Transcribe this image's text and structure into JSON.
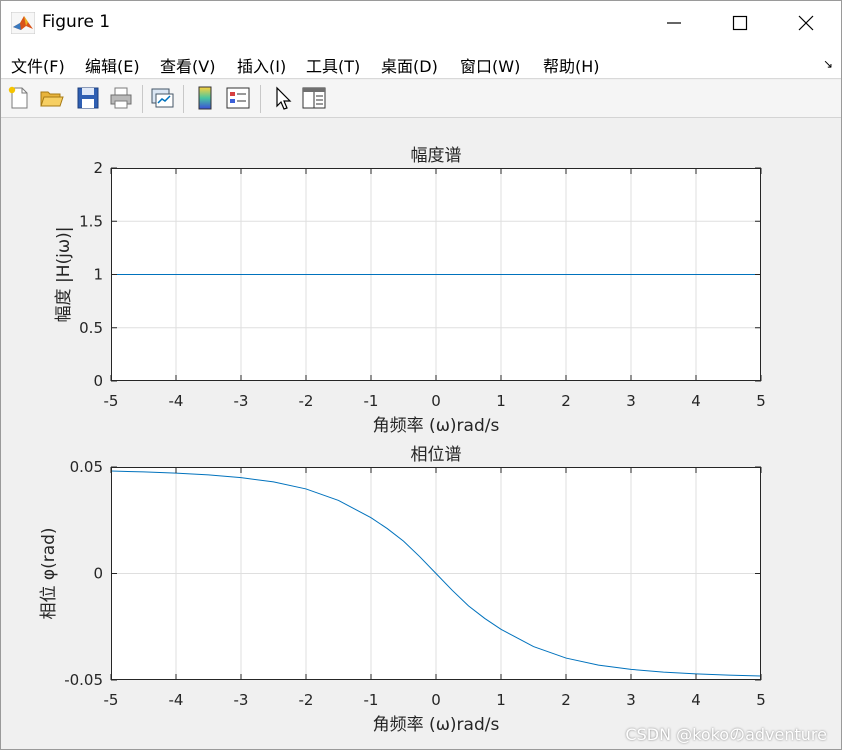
{
  "window": {
    "title": "Figure 1"
  },
  "menu": [
    "文件(F)",
    "编辑(E)",
    "查看(V)",
    "插入(I)",
    "工具(T)",
    "桌面(D)",
    "窗口(W)",
    "帮助(H)"
  ],
  "toolbar_icons": [
    "new-file-icon",
    "open-folder-icon",
    "save-icon",
    "print-icon",
    "link-plot-icon",
    "colorbar-icon",
    "legend-icon",
    "cursor-icon",
    "property-inspector-icon"
  ],
  "colors": {
    "line": "#0072bd",
    "grid": "#dfdfdf",
    "axes_bg": "#ffffff",
    "figure_bg": "#f0f0f0"
  },
  "watermark": "CSDN @kokoのadventure",
  "chart_data": [
    {
      "type": "line",
      "title": "幅度谱",
      "xlabel": "角频率 (ω)rad/s",
      "ylabel": "幅度 |H(jω)|",
      "xlim": [
        -5,
        5
      ],
      "ylim": [
        0,
        2
      ],
      "xticks": [
        -5,
        -4,
        -3,
        -2,
        -1,
        0,
        1,
        2,
        3,
        4,
        5
      ],
      "yticks": [
        0,
        0.5,
        1,
        1.5,
        2
      ],
      "xticklabels": [
        "-5",
        "-4",
        "-3",
        "-2",
        "-1",
        "0",
        "1",
        "2",
        "3",
        "4",
        "5"
      ],
      "yticklabels": [
        "0",
        "0.5",
        "1",
        "1.5",
        "2"
      ],
      "grid": true,
      "series": [
        {
          "x": [
            -5,
            -4,
            -3,
            -2,
            -1,
            0,
            1,
            2,
            3,
            4,
            5
          ],
          "y": [
            1,
            1,
            1,
            1,
            1,
            1,
            1,
            1,
            1,
            1,
            1
          ]
        }
      ]
    },
    {
      "type": "line",
      "title": "相位谱",
      "xlabel": "角频率 (ω)rad/s",
      "ylabel": "相位 φ(rad)",
      "xlim": [
        -5,
        5
      ],
      "ylim": [
        -0.05,
        0.05
      ],
      "xticks": [
        -5,
        -4,
        -3,
        -2,
        -1,
        0,
        1,
        2,
        3,
        4,
        5
      ],
      "yticks": [
        -0.05,
        0,
        0.05
      ],
      "xticklabels": [
        "-5",
        "-4",
        "-3",
        "-2",
        "-1",
        "0",
        "1",
        "2",
        "3",
        "4",
        "5"
      ],
      "yticklabels": [
        "-0.05",
        "0",
        "0.05"
      ],
      "grid": true,
      "series": [
        {
          "x": [
            -5,
            -4.5,
            -4,
            -3.5,
            -3,
            -2.5,
            -2,
            -1.5,
            -1,
            -0.75,
            -0.5,
            -0.25,
            0,
            0.25,
            0.5,
            0.75,
            1,
            1.5,
            2,
            2.5,
            3,
            3.5,
            4,
            4.5,
            5
          ],
          "y": [
            0.0481,
            0.0477,
            0.0471,
            0.0463,
            0.045,
            0.043,
            0.0397,
            0.0343,
            0.0262,
            0.0211,
            0.0152,
            0.0079,
            0.0,
            -0.0079,
            -0.0152,
            -0.0211,
            -0.0262,
            -0.0343,
            -0.0397,
            -0.043,
            -0.045,
            -0.0463,
            -0.0471,
            -0.0477,
            -0.0481
          ]
        }
      ]
    }
  ]
}
